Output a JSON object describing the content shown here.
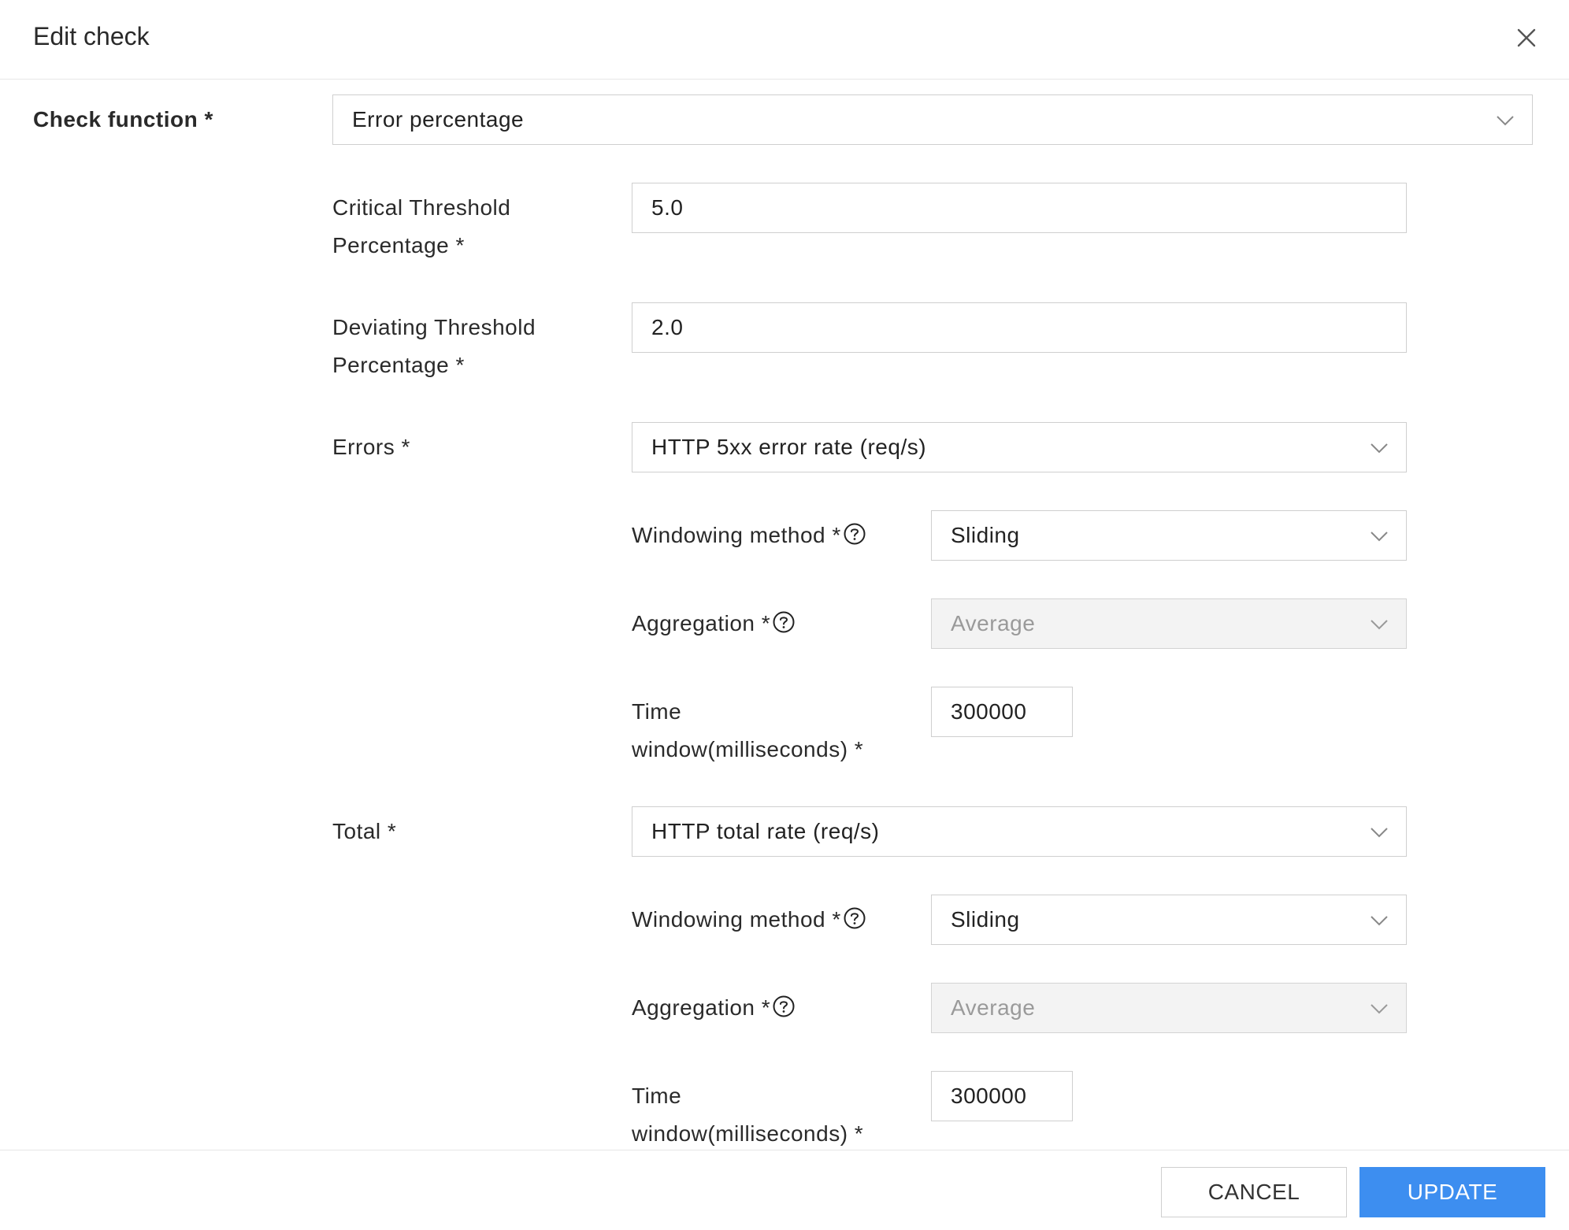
{
  "dialog": {
    "title": "Edit check",
    "close_icon": "close-icon"
  },
  "form": {
    "check_function": {
      "label": "Check function *",
      "value": "Error percentage"
    },
    "critical_threshold": {
      "label_line1": "Critical Threshold",
      "label_line2": "Percentage *",
      "value": "5.0"
    },
    "deviating_threshold": {
      "label_line1": "Deviating Threshold",
      "label_line2": "Percentage *",
      "value": "2.0"
    },
    "errors": {
      "label": "Errors *",
      "value": "HTTP 5xx error rate (req/s)",
      "windowing_label": "Windowing method *",
      "windowing_value": "Sliding",
      "aggregation_label": "Aggregation *",
      "aggregation_value": "Average",
      "time_window_line1": "Time",
      "time_window_line2": "window(milliseconds) *",
      "time_window_value": "300000"
    },
    "total": {
      "label": "Total *",
      "value": "HTTP total rate (req/s)",
      "windowing_label": "Windowing method *",
      "windowing_value": "Sliding",
      "aggregation_label": "Aggregation *",
      "aggregation_value": "Average",
      "time_window_line1": "Time",
      "time_window_line2": "window(milliseconds) *",
      "time_window_value": "300000"
    }
  },
  "footer": {
    "cancel_label": "CANCEL",
    "update_label": "UPDATE"
  },
  "colors": {
    "primary": "#3d8ef0",
    "disabled_bg": "#f3f3f3",
    "border": "#cfcfcf"
  }
}
